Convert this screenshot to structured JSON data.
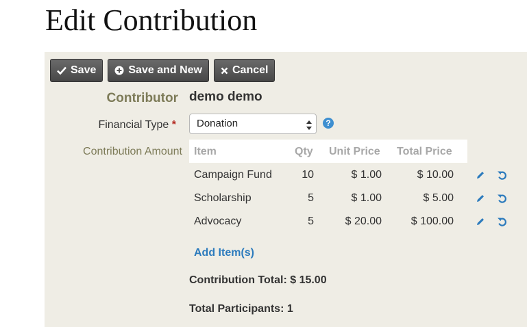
{
  "page": {
    "title": "Edit Contribution"
  },
  "toolbar": {
    "save_label": "Save",
    "save_new_label": "Save and New",
    "cancel_label": "Cancel"
  },
  "form": {
    "contributor_label": "Contributor",
    "contributor_name": "demo demo",
    "financial_type_label": "Financial Type",
    "required_marker": "*",
    "financial_type_value": "Donation",
    "help_symbol": "?",
    "amount_label": "Contribution Amount"
  },
  "line_items": {
    "headers": [
      "Item",
      "Qty",
      "Unit Price",
      "Total Price"
    ],
    "rows": [
      {
        "item": "Campaign Fund",
        "qty": "10",
        "unit_price": "$ 1.00",
        "total_price": "$ 10.00"
      },
      {
        "item": "Scholarship",
        "qty": "5",
        "unit_price": "$ 1.00",
        "total_price": "$ 5.00"
      },
      {
        "item": "Advocacy",
        "qty": "5",
        "unit_price": "$ 20.00",
        "total_price": "$ 100.00"
      }
    ],
    "add_label": "Add Item(s)"
  },
  "summary": {
    "contribution_total": "Contribution Total: $ 15.00",
    "total_participants": "Total Participants: 1"
  },
  "colors": {
    "panel_bg": "#efede5",
    "link_blue": "#2c7bbd",
    "label_olive": "#7d7b58"
  }
}
